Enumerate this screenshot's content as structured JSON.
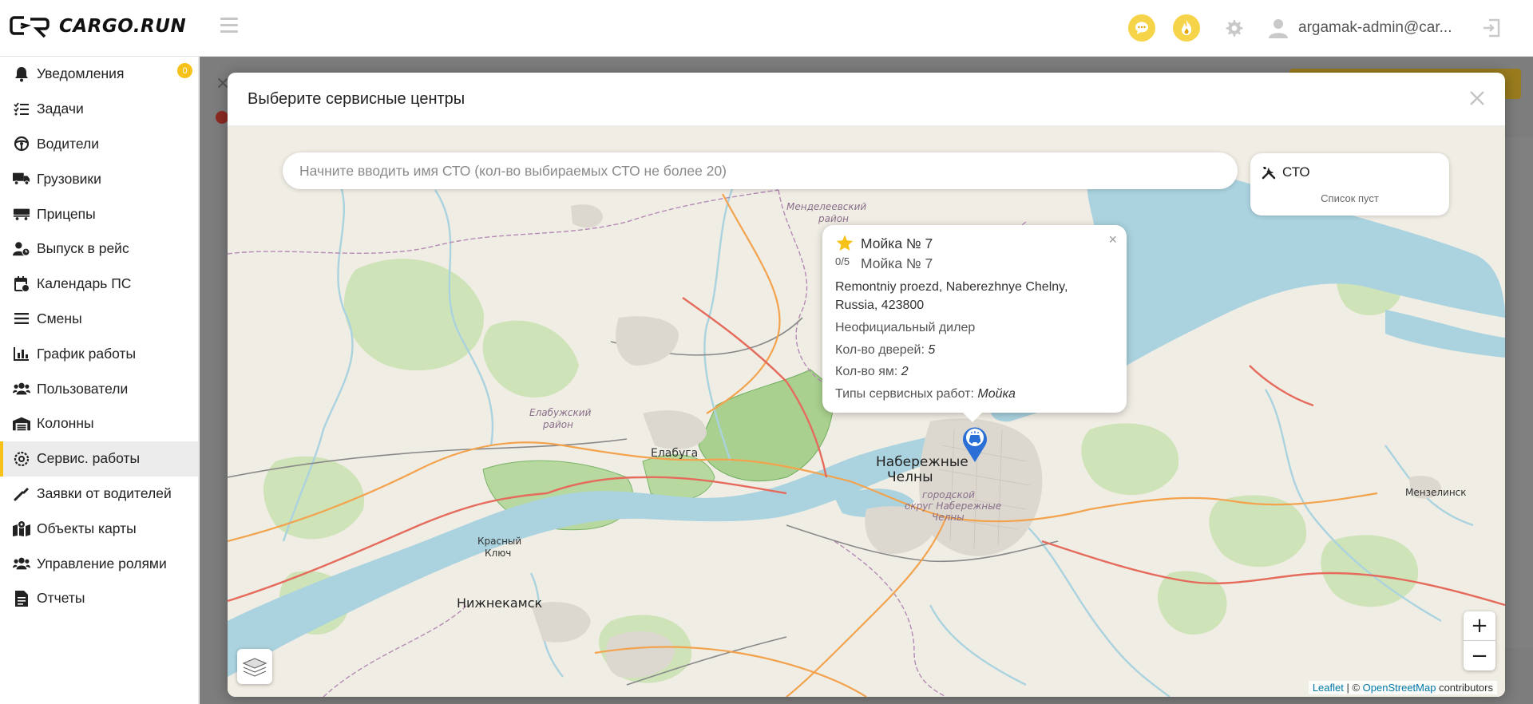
{
  "app": {
    "logo_text": "CARGO.RUN"
  },
  "header": {
    "username": "argamak-admin@car..."
  },
  "sidebar": {
    "items": [
      {
        "label": "Уведомления",
        "badge": "0",
        "icon": "bell-icon"
      },
      {
        "label": "Задачи",
        "icon": "tasks-icon"
      },
      {
        "label": "Водители",
        "icon": "steering-wheel-icon"
      },
      {
        "label": "Грузовики",
        "icon": "truck-icon"
      },
      {
        "label": "Прицепы",
        "icon": "trailer-icon"
      },
      {
        "label": "Выпуск в рейс",
        "icon": "user-clock-icon"
      },
      {
        "label": "Календарь ПС",
        "icon": "calendar-icon"
      },
      {
        "label": "Смены",
        "icon": "list-icon"
      },
      {
        "label": "График работы",
        "icon": "chart-icon"
      },
      {
        "label": "Пользователи",
        "icon": "users-icon"
      },
      {
        "label": "Колонны",
        "icon": "warehouse-icon"
      },
      {
        "label": "Сервис. работы",
        "icon": "cog-icon",
        "active": true
      },
      {
        "label": "Заявки от водителей",
        "icon": "wrench-icon"
      },
      {
        "label": "Объекты карты",
        "icon": "map-marked-icon"
      },
      {
        "label": "Управление ролями",
        "icon": "users-cog-icon"
      },
      {
        "label": "Отчеты",
        "icon": "report-icon"
      }
    ]
  },
  "modal": {
    "title": "Выберите сервисные центры",
    "search_placeholder": "Начните вводить имя СТО (кол-во выбираемых СТО не более 20)",
    "sto_panel": {
      "title": "СТО",
      "empty_text": "Список пуст"
    },
    "popup": {
      "name": "Мойка № 7",
      "subname": "Мойка № 7",
      "rating": "0/5",
      "address": "Remontniy proezd, Naberezhnye Chelny, Russia, 423800",
      "dealer": "Неофициальный дилер",
      "doors_label": "Кол-во дверей:",
      "doors_value": "5",
      "pits_label": "Кол-во ям:",
      "pits_value": "2",
      "works_label": "Типы сервисных работ:",
      "works_value": "Мойка",
      "close": "×"
    },
    "map_labels": {
      "mendeleevsk": "Менделеевский",
      "mendeleevsk_region": "район",
      "elabuga_region_1": "Елабужский",
      "elabuga_region_2": "район",
      "elabuga": "Елабуга",
      "chelny_1": "Набережные",
      "chelny_2": "Челны",
      "chelny_okrug_1": "городской",
      "chelny_okrug_2": "округ Набережные",
      "chelny_okrug_3": "Челны",
      "krasny_klyuch_1": "Красный",
      "krasny_klyuch_2": "Ключ",
      "nizhnekamsk": "Нижнекамск",
      "menzelinsk": "Мензелинск"
    },
    "zoom": {
      "in": "+",
      "out": "−"
    },
    "attribution": {
      "leaflet": "Leaflet",
      "sep": " | © ",
      "osm": "OpenStreetMap",
      "contrib": " contributors"
    }
  },
  "colors": {
    "accent": "#f6c21a",
    "marker": "#2a6fd6"
  }
}
